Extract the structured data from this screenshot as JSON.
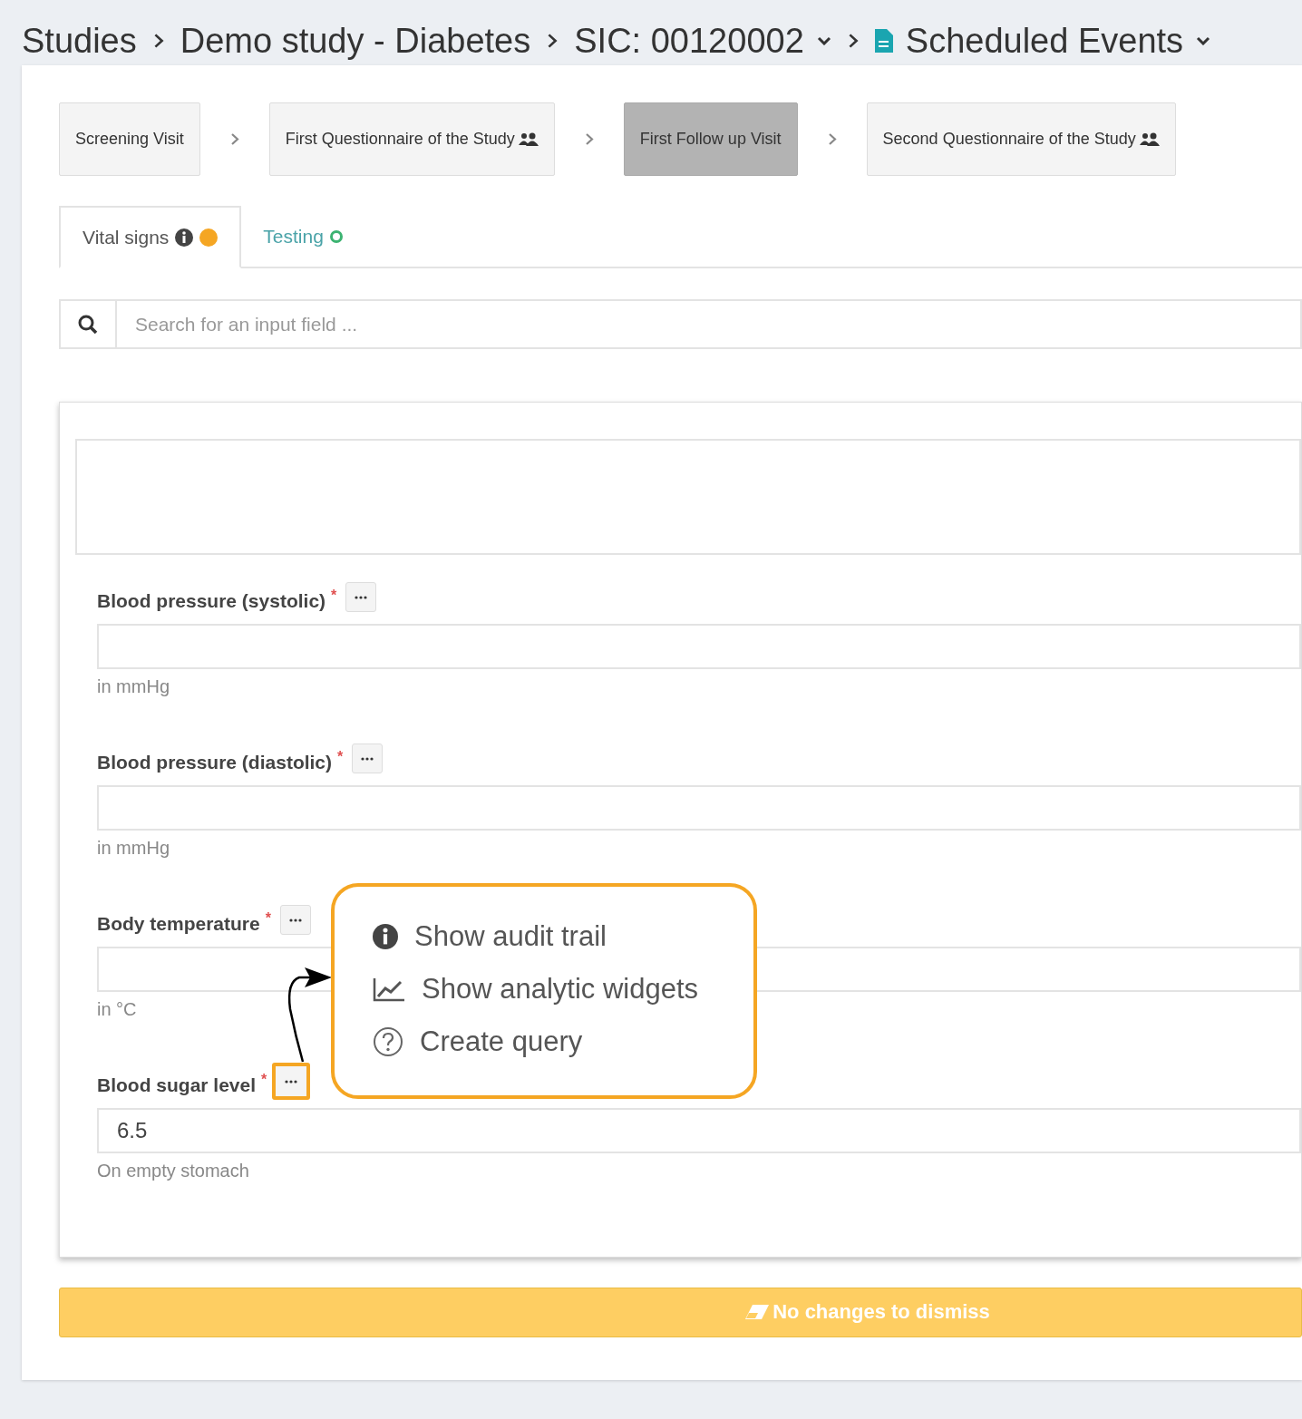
{
  "breadcrumb": [
    {
      "label": "Studies",
      "kind": "plain"
    },
    {
      "label": "Demo study - Diabetes",
      "kind": "plain"
    },
    {
      "label": "SIC: 00120002",
      "kind": "plain",
      "dropdown": true
    },
    {
      "label": "Scheduled Events",
      "kind": "document",
      "dropdown": true
    }
  ],
  "steps": [
    {
      "label": "Screening Visit",
      "group": false,
      "selected": false
    },
    {
      "label": "First Questionnaire of the Study",
      "group": true,
      "selected": false
    },
    {
      "label": "First Follow up Visit",
      "group": false,
      "selected": true
    },
    {
      "label": "Second Questionnaire of the Study",
      "group": true,
      "selected": false
    }
  ],
  "tabs": [
    {
      "label": "Vital signs",
      "info": true,
      "kind": "filled",
      "color": "#f5a623",
      "selected": true
    },
    {
      "label": "Testing",
      "info": false,
      "kind": "ring",
      "color": "#3cb371",
      "selected": false
    }
  ],
  "search": {
    "placeholder": "Search for an input field ..."
  },
  "fields": [
    {
      "label": "Blood pressure (systolic)",
      "required_mark": "*",
      "hint": "in mmHg",
      "highlighted": false
    },
    {
      "label": "Blood pressure (diastolic)",
      "required_mark": "*",
      "hint": "in mmHg",
      "highlighted": false
    },
    {
      "label": "Body temperature",
      "required_mark": "*",
      "hint": "in °C",
      "highlighted": false
    },
    {
      "label": "Blood sugar level",
      "required_mark": "*",
      "value": "6.5",
      "hint": "On empty stomach",
      "highlighted": true
    }
  ],
  "menu": {
    "items": [
      {
        "label": "Show audit trail",
        "kind": "info"
      },
      {
        "label": "Show analytic widgets",
        "kind": "chart"
      },
      {
        "label": "Create query",
        "kind": "question"
      }
    ]
  },
  "dismiss_button": {
    "label": "No changes to dismiss",
    "disabled": true
  }
}
